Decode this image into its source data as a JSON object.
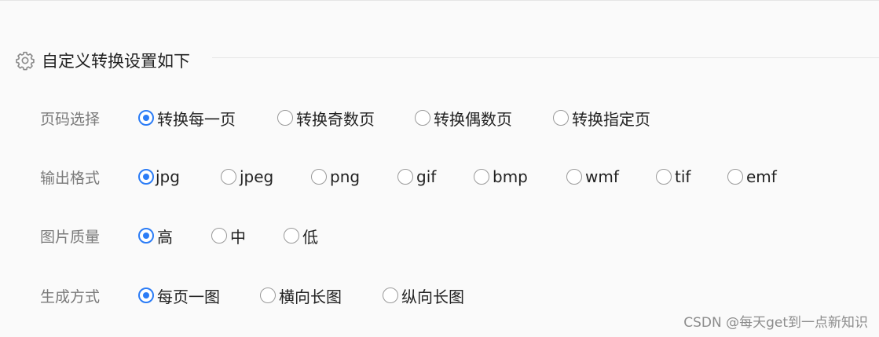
{
  "section": {
    "title": "自定义转换设置如下",
    "icon": "gear-icon"
  },
  "accent_color": "#2b7cf6",
  "rows": [
    {
      "label": "页码选择",
      "options": [
        "转换每一页",
        "转换奇数页",
        "转换偶数页",
        "转换指定页"
      ],
      "selected": 0
    },
    {
      "label": "输出格式",
      "options": [
        "jpg",
        "jpeg",
        "png",
        "gif",
        "bmp",
        "wmf",
        "tif",
        "emf"
      ],
      "selected": 0
    },
    {
      "label": "图片质量",
      "options": [
        "高",
        "中",
        "低"
      ],
      "selected": 0
    },
    {
      "label": "生成方式",
      "options": [
        "每页一图",
        "横向长图",
        "纵向长图"
      ],
      "selected": 0
    }
  ],
  "watermark": "CSDN @每天get到一点新知识"
}
